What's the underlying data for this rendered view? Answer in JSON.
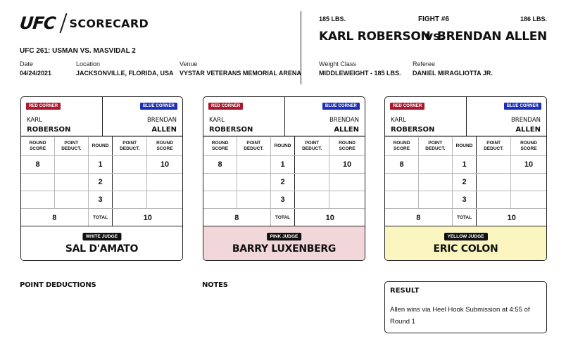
{
  "header": {
    "logo_ufc": "UFC",
    "logo_text": "SCORECARD",
    "event_title": "UFC 261: USMAN VS. MASVIDAL 2",
    "date_label": "Date",
    "date": "04/24/2021",
    "location_label": "Location",
    "location": "JACKSONVILLE, FLORIDA, USA",
    "venue_label": "Venue",
    "venue": "VYSTAR VETERANS MEMORIAL ARENA"
  },
  "fight": {
    "number": "FIGHT #6",
    "red_weight": "185 LBS.",
    "blue_weight": "186 LBS.",
    "red_fighter": "KARL ROBERSON",
    "vs": "vs.",
    "blue_fighter": "BRENDAN ALLEN",
    "weight_class_label": "Weight Class",
    "weight_class": "MIDDLEWEIGHT - 185 LBS.",
    "referee_label": "Referee",
    "referee": "DANIEL MIRAGLIOTTA JR."
  },
  "labels": {
    "red_corner": "RED CORNER",
    "blue_corner": "BLUE CORNER",
    "round_score_1": "ROUND",
    "round_score_2": "SCORE",
    "point_deduct_1": "POINT",
    "point_deduct_2": "DEDUCT.",
    "round": "ROUND",
    "total": "TOTAL",
    "red_first": "KARL",
    "red_last": "ROBERSON",
    "blue_first": "BRENDAN",
    "blue_last": "ALLEN"
  },
  "cards": [
    {
      "judge_tag": "WHITE JUDGE",
      "judge_name": "SAL D'AMATO",
      "color": "#ffffff",
      "rounds": [
        {
          "round": "1",
          "red_score": "8",
          "red_deduct": "",
          "blue_deduct": "",
          "blue_score": "10"
        },
        {
          "round": "2",
          "red_score": "",
          "red_deduct": "",
          "blue_deduct": "",
          "blue_score": ""
        },
        {
          "round": "3",
          "red_score": "",
          "red_deduct": "",
          "blue_deduct": "",
          "blue_score": ""
        }
      ],
      "red_total": "8",
      "blue_total": "10"
    },
    {
      "judge_tag": "PINK JUDGE",
      "judge_name": "BARRY LUXENBERG",
      "color": "#f2d7da",
      "rounds": [
        {
          "round": "1",
          "red_score": "8",
          "red_deduct": "",
          "blue_deduct": "",
          "blue_score": "10"
        },
        {
          "round": "2",
          "red_score": "",
          "red_deduct": "",
          "blue_deduct": "",
          "blue_score": ""
        },
        {
          "round": "3",
          "red_score": "",
          "red_deduct": "",
          "blue_deduct": "",
          "blue_score": ""
        }
      ],
      "red_total": "8",
      "blue_total": "10"
    },
    {
      "judge_tag": "YELLOW JUDGE",
      "judge_name": "ERIC COLON",
      "color": "#fbf5bf",
      "rounds": [
        {
          "round": "1",
          "red_score": "8",
          "red_deduct": "",
          "blue_deduct": "",
          "blue_score": "10"
        },
        {
          "round": "2",
          "red_score": "",
          "red_deduct": "",
          "blue_deduct": "",
          "blue_score": ""
        },
        {
          "round": "3",
          "red_score": "",
          "red_deduct": "",
          "blue_deduct": "",
          "blue_score": ""
        }
      ],
      "red_total": "8",
      "blue_total": "10"
    }
  ],
  "sections": {
    "point_deductions": "POINT DEDUCTIONS",
    "notes": "NOTES",
    "result_title": "RESULT",
    "result_text": "Allen wins via Heel Hook Submission at 4:55 of Round 1"
  },
  "colors": {
    "red_corner": "#a8192e",
    "blue_corner": "#1c2fb8"
  }
}
